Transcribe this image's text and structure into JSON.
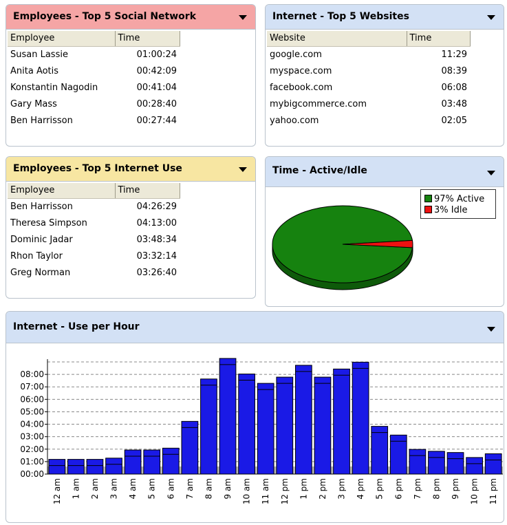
{
  "panels": {
    "social": {
      "title": "Employees - Top 5 Social Network",
      "columns": [
        "Employee",
        "Time"
      ],
      "rows": [
        {
          "name": "Susan Lassie",
          "time": "01:00:24"
        },
        {
          "name": "Anita Aotis",
          "time": "00:42:09"
        },
        {
          "name": "Konstantin Nagodin",
          "time": "00:41:04"
        },
        {
          "name": "Gary Mass",
          "time": "00:28:40"
        },
        {
          "name": "Ben Harrisson",
          "time": "00:27:44"
        }
      ]
    },
    "websites": {
      "title": "Internet - Top 5 Websites",
      "columns": [
        "Website",
        "Time"
      ],
      "rows": [
        {
          "name": "google.com",
          "time": "11:29"
        },
        {
          "name": "myspace.com",
          "time": "08:39"
        },
        {
          "name": "facebook.com",
          "time": "06:08"
        },
        {
          "name": "mybigcommerce.com",
          "time": "03:48"
        },
        {
          "name": "yahoo.com",
          "time": "02:05"
        }
      ]
    },
    "internet_use": {
      "title": "Employees - Top 5 Internet Use",
      "columns": [
        "Employee",
        "Time"
      ],
      "rows": [
        {
          "name": "Ben Harrisson",
          "time": "04:26:29"
        },
        {
          "name": "Theresa Simpson",
          "time": "04:13:00"
        },
        {
          "name": "Dominic Jadar",
          "time": "03:48:34"
        },
        {
          "name": "Rhon Taylor",
          "time": "03:32:14"
        },
        {
          "name": "Greg Norman",
          "time": "03:26:40"
        }
      ]
    },
    "active_idle": {
      "title": "Time - Active/Idle"
    },
    "per_hour": {
      "title": "Internet - Use per Hour"
    }
  },
  "colors": {
    "social_header": "#f5a5a5",
    "websites_header": "#d3e1f5",
    "internet_use_header": "#f7e6a2",
    "active_idle_header": "#d3e1f5",
    "per_hour_header": "#d3e1f5",
    "active": "#16820f",
    "idle": "#ee1111",
    "bar": "#1a1ae6"
  },
  "chart_data": [
    {
      "type": "pie",
      "labels": [
        "97% Active",
        "3% Idle"
      ],
      "values": [
        97,
        3
      ],
      "legend": "top-right"
    },
    {
      "type": "bar",
      "categories": [
        "12 am",
        "1 am",
        "2 am",
        "3 am",
        "4 am",
        "5 am",
        "6 am",
        "7 am",
        "8 am",
        "9 am",
        "10 am",
        "11 am",
        "12 pm",
        "1 pm",
        "2 pm",
        "3 pm",
        "4 pm",
        "5 pm",
        "6 pm",
        "7 pm",
        "8 pm",
        "9 pm",
        "10 pm",
        "11 pm"
      ],
      "values": [
        0.85,
        0.85,
        0.85,
        0.95,
        1.6,
        1.6,
        1.75,
        3.9,
        7.3,
        8.95,
        7.7,
        6.95,
        7.45,
        8.4,
        7.45,
        8.1,
        8.65,
        3.5,
        2.8,
        1.65,
        1.5,
        1.4,
        1.0,
        1.3
      ],
      "yticks": [
        "00:00",
        "01:00",
        "02:00",
        "03:00",
        "04:00",
        "05:00",
        "06:00",
        "07:00",
        "08:00"
      ],
      "ylim": [
        0,
        9
      ],
      "grid": true
    }
  ]
}
